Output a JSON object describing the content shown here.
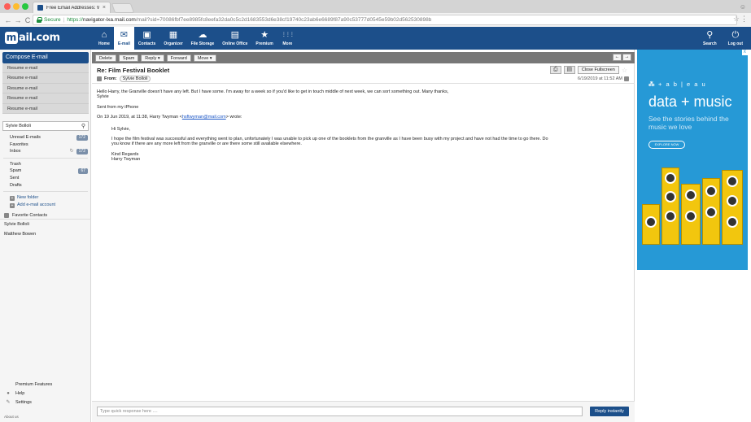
{
  "browser": {
    "tab_title": "Free Email Addresses: Web ba",
    "tab_close": "×",
    "secure_label": "Secure",
    "url_scheme": "https://",
    "url_host": "navigator-lxa.mail.com",
    "url_rest": "/mail?sid=70086fbf7ee8985fc8eefa32da0c5c2d1683553d6e38cf19740c23ab6e6689f87a90c53777d0545e59b02d562530898b",
    "nav_back": "←",
    "nav_forward": "→",
    "nav_reload": "C",
    "star_glyph": "☆",
    "menu_glyph": "⋮",
    "profile_glyph": "☺"
  },
  "app": {
    "logo_letter": "m",
    "logo_text": "ail.com",
    "nav": [
      {
        "label": "Home",
        "glyph": "⌂"
      },
      {
        "label": "E-mail",
        "glyph": "✉"
      },
      {
        "label": "Contacts",
        "glyph": "▣"
      },
      {
        "label": "Organizer",
        "glyph": "▦"
      },
      {
        "label": "File Storage",
        "glyph": "☁"
      },
      {
        "label": "Online Office",
        "glyph": "▤"
      },
      {
        "label": "Premium",
        "glyph": "★"
      },
      {
        "label": "More",
        "glyph": "⋮⋮⋮"
      }
    ],
    "right_nav": [
      {
        "label": "Search",
        "glyph": "⚲"
      },
      {
        "label": "Log out",
        "glyph": "⏻"
      }
    ]
  },
  "sidebar": {
    "compose_label": "Compose E-mail",
    "resume_items": [
      "Resume e-mail",
      "Resume e-mail",
      "Resume e-mail",
      "Resume e-mail",
      "Resume e-mail"
    ],
    "search_value": "Sylvie Bolloli",
    "search_glyph": "⚲",
    "folders_top": [
      {
        "name": "Unread E-mails",
        "badge": "172"
      },
      {
        "name": "Favorites",
        "badge": ""
      },
      {
        "name": "Inbox",
        "badge": "172",
        "sync": "↻"
      }
    ],
    "folders_bottom": [
      {
        "name": "Trash",
        "badge": ""
      },
      {
        "name": "Spam",
        "badge": "67"
      },
      {
        "name": "Sent",
        "badge": ""
      },
      {
        "name": "Drafts",
        "badge": ""
      }
    ],
    "new_folder_label": "New folder",
    "add_account_label": "Add e-mail account",
    "plus_glyph": "+",
    "favorite_contacts_label": "Favorite Contacts",
    "contacts": [
      "Sylvie Bolloli",
      "Matthew Bowen"
    ],
    "bottom": [
      {
        "label": "Premium Features",
        "glyph": ""
      },
      {
        "label": "Help",
        "glyph": "●"
      },
      {
        "label": "Settings",
        "glyph": "✎"
      }
    ],
    "about_label": "About us"
  },
  "message": {
    "toolbar": {
      "delete": "Delete",
      "spam": "Spam",
      "reply": "Reply ▾",
      "forward": "Forward",
      "move": "Move ▾",
      "prev": "←",
      "next": "→"
    },
    "subject": "Re: Film Festival Booklet",
    "print_glyph": "⎙",
    "save_glyph": "▤",
    "close_fullscreen": "Close Fullscreen",
    "fav_glyph": "☆",
    "from_label": "From:",
    "from_name": "Sylvie Bolloli",
    "date": "6/19/2019 at 11:52 AM",
    "body_lines": [
      "Hello Harry, the Granville doesn't have any left. But I have some. I'm away for a week so if you'd like to get in touch middle of next week, we can sort something out. Many thanks,",
      "Sylvie"
    ],
    "signature": "Sent from my iPhone",
    "quote_intro_prefix": "On 19 Jun 2019, at 11:38, Harry Twyman <",
    "quote_email": "hsftwyman@mail.com",
    "quote_intro_suffix": "> wrote:",
    "quote_greeting": "Hi Sylvie,",
    "quote_body_1": "I hope the film festival was successful and everything went to plan, unfortunately I was unable to pick up one of the booklets from the granville as I have been busy with my project and have not had the time to go there. Do",
    "quote_body_2": "you know if there are any more left from the granville or are there some still available elsewhere.",
    "quote_closing_1": "Kind Regards",
    "quote_closing_2": "Harry Twyman",
    "reply_placeholder": "Type quick response here ....",
    "reply_button": "Reply instantly"
  },
  "ad": {
    "close_label": "X",
    "logo_mark": "⁂",
    "logo_text": "+ a b | e a u",
    "headline": "data + music",
    "sub": "See the stories behind the music we love",
    "cta": "EXPLORE NOW",
    "colors": {
      "background": "#2699d6",
      "speaker": "#f2c60e"
    }
  },
  "colors": {
    "brand": "#1c4f8a",
    "badge": "#7a8fa9"
  }
}
